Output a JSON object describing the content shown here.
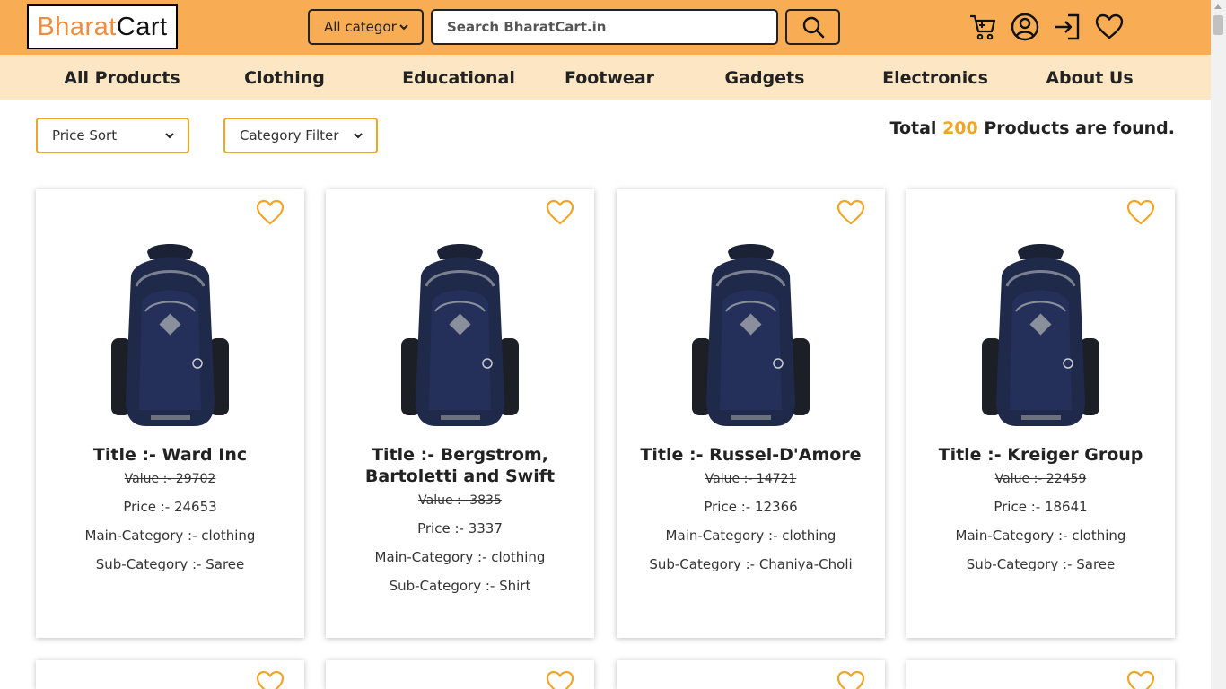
{
  "header": {
    "logo_part1": "Bharat",
    "logo_part2": "Cart",
    "category_select": "All categor",
    "search_placeholder": "Search BharatCart.in",
    "icons": [
      "cart-icon",
      "user-icon",
      "login-icon",
      "heart-icon"
    ]
  },
  "nav": {
    "items": [
      "All Products",
      "Clothing",
      "Educational",
      "Footwear",
      "Gadgets",
      "Electronics",
      "About Us"
    ]
  },
  "filters": {
    "price_sort": "Price Sort",
    "category_filter": "Category Filter"
  },
  "summary": {
    "prefix": "Total",
    "count": "200",
    "suffix": "Products are found."
  },
  "products": [
    {
      "title": "Title :- Ward Inc",
      "value": "Value :- 29702",
      "price": "Price :- 24653",
      "main_category": "Main-Category :- clothing",
      "sub_category": "Sub-Category :- Saree"
    },
    {
      "title": "Title :- Bergstrom, Bartoletti and Swift",
      "value": "Value :- 3835",
      "price": "Price :- 3337",
      "main_category": "Main-Category :- clothing",
      "sub_category": "Sub-Category :- Shirt"
    },
    {
      "title": "Title :- Russel-D'Amore",
      "value": "Value :- 14721",
      "price": "Price :- 12366",
      "main_category": "Main-Category :- clothing",
      "sub_category": "Sub-Category :- Chaniya-Choli"
    },
    {
      "title": "Title :- Kreiger Group",
      "value": "Value :- 22459",
      "price": "Price :- 18641",
      "main_category": "Main-Category :- clothing",
      "sub_category": "Sub-Category :- Saree"
    }
  ],
  "colors": {
    "header_bg": "#f8ad55",
    "nav_bg": "#fde6c3",
    "accent": "#f0a526",
    "logo_orange": "#f08c3e"
  }
}
